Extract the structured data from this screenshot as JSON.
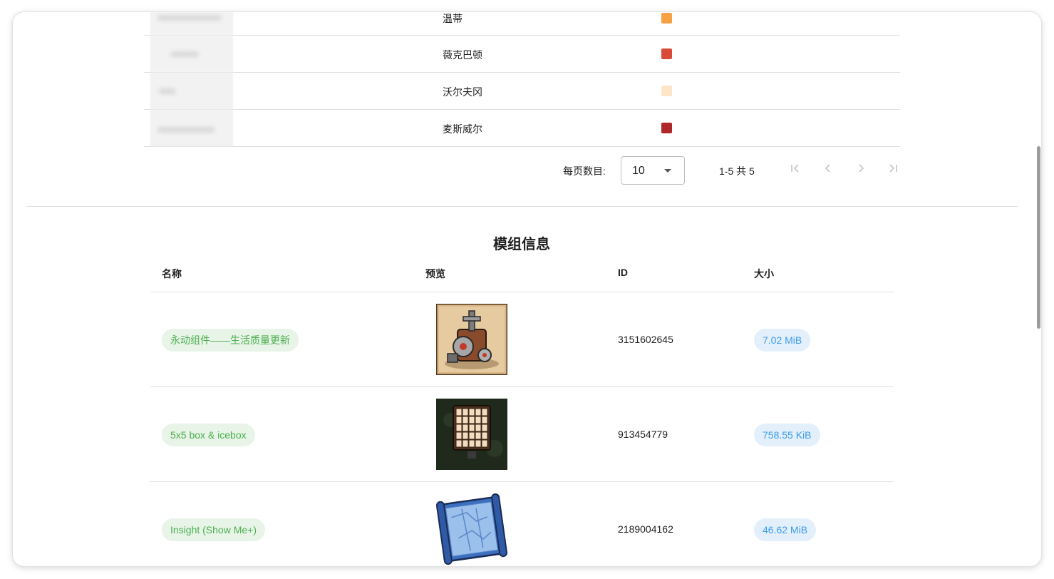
{
  "players": [
    {
      "name": "温蒂",
      "color": "#f7a044"
    },
    {
      "name": "薇克巴顿",
      "color": "#d94b38"
    },
    {
      "name": "沃尔夫冈",
      "color": "#fde6c8"
    },
    {
      "name": "麦斯威尔",
      "color": "#b0262a"
    }
  ],
  "pagination": {
    "rows_per_page_label": "每页数目:",
    "rows_per_page_value": "10",
    "range_text": "1-5 共 5"
  },
  "mods": {
    "title": "模组信息",
    "columns": {
      "name": "名称",
      "preview": "预览",
      "id": "ID",
      "size": "大小"
    },
    "rows": [
      {
        "name": "永动组件——生活质量更新",
        "preview": "machine-icon",
        "id": "3151602645",
        "size": "7.02 MiB"
      },
      {
        "name": "5x5 box & icebox",
        "preview": "box-grid-icon",
        "id": "913454779",
        "size": "758.55 KiB"
      },
      {
        "name": "Insight (Show Me+)",
        "preview": "blueprint-scroll-icon",
        "id": "2189004162",
        "size": "46.62 MiB"
      }
    ]
  },
  "colors": {
    "chip_green_bg": "#e7f4e7",
    "chip_green_text": "#4caf50",
    "chip_blue_bg": "#e3f0fc",
    "chip_blue_text": "#3d9be9"
  }
}
